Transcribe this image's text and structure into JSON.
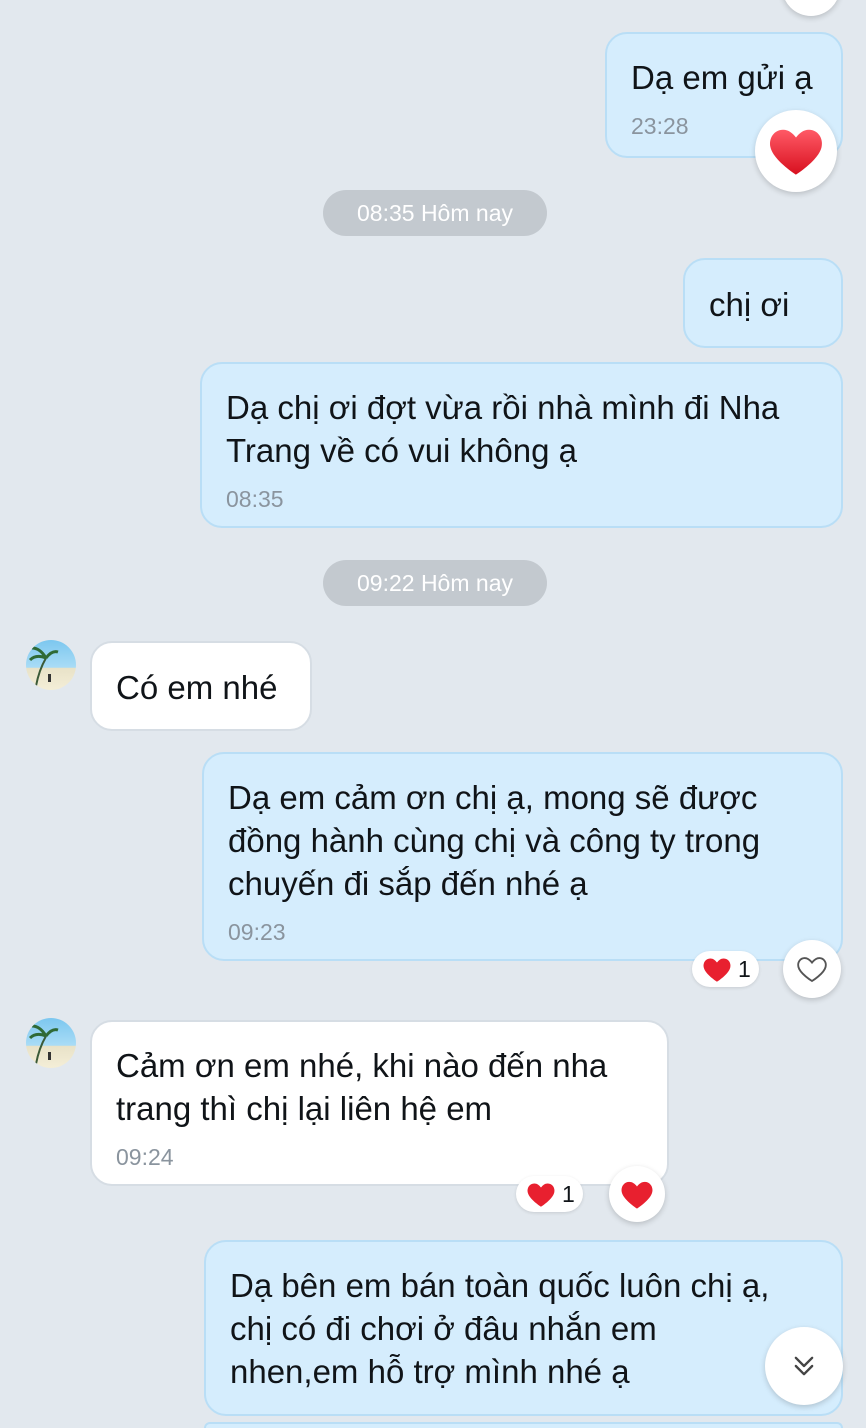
{
  "messages": [
    {
      "text": "Dạ em gửi ạ",
      "time": "23:28"
    },
    {
      "text": "chị ơi"
    },
    {
      "text": "Dạ chị ơi đợt vừa rồi nhà mình đi Nha\nTrang về có vui không ạ",
      "time": "08:35"
    },
    {
      "text": "Có em nhé"
    },
    {
      "text": "Dạ em cảm ơn chị ạ, mong sẽ được\nđồng hành cùng chị và công ty trong\nchuyến đi sắp đến nhé ạ",
      "time": "09:23",
      "reaction_count": "1"
    },
    {
      "text": "Cảm ơn em nhé, khi nào đến nha\ntrang thì chị lại liên hệ em",
      "time": "09:24",
      "reaction_count": "1"
    },
    {
      "text": "Dạ bên em bán toàn quốc luôn chị ạ,\nchị có đi chơi ở đâu nhắn em\nnhen,em hỗ trợ mình nhé ạ"
    }
  ],
  "separators": [
    "08:35 Hôm nay",
    "09:22 Hôm nay"
  ],
  "icons": {
    "heart": "heart-icon",
    "heart_outline": "heart-outline-icon",
    "scroll_down": "chevron-double-down-icon",
    "avatar": "contact-avatar"
  },
  "colors": {
    "outgoing_bubble": "#d5edfd",
    "incoming_bubble": "#ffffff",
    "background": "#e2e8ee",
    "heart": "#e8202f"
  }
}
